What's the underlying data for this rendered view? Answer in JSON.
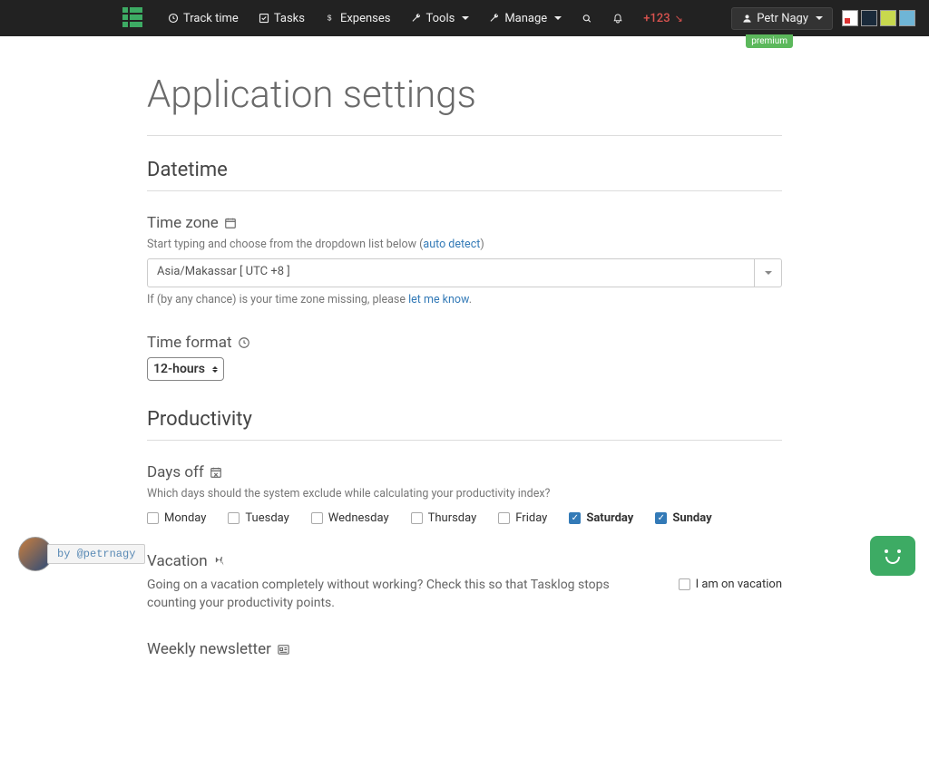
{
  "nav": {
    "track": "Track time",
    "tasks": "Tasks",
    "expenses": "Expenses",
    "tools": "Tools",
    "manage": "Manage",
    "count": "+123",
    "user": "Petr Nagy"
  },
  "badge": "premium",
  "page_title": "Application settings",
  "datetime": {
    "heading": "Datetime",
    "tz_label": "Time zone",
    "tz_helper_pre": "Start typing and choose from the dropdown list below (",
    "tz_helper_link": "auto detect",
    "tz_helper_post": ")",
    "tz_value": "Asia/Makassar   [ UTC +8 ]",
    "tz_missing_pre": "If (by any chance) is your time zone missing, please ",
    "tz_missing_link": "let me know",
    "tz_missing_post": ".",
    "tf_label": "Time format",
    "tf_value": "12-hours"
  },
  "productivity": {
    "heading": "Productivity",
    "days_label": "Days off",
    "days_helper": "Which days should the system exclude while calculating your productivity index?",
    "days": [
      {
        "label": "Monday",
        "checked": false
      },
      {
        "label": "Tuesday",
        "checked": false
      },
      {
        "label": "Wednesday",
        "checked": false
      },
      {
        "label": "Thursday",
        "checked": false
      },
      {
        "label": "Friday",
        "checked": false
      },
      {
        "label": "Saturday",
        "checked": true
      },
      {
        "label": "Sunday",
        "checked": true
      }
    ],
    "vacation_label": "Vacation",
    "vacation_desc": "Going on a vacation completely without working? Check this so that Tasklog stops counting your productivity points.",
    "vacation_check": "I am on vacation",
    "newsletter_label": "Weekly newsletter"
  },
  "by_widget": "by @petrnagy"
}
